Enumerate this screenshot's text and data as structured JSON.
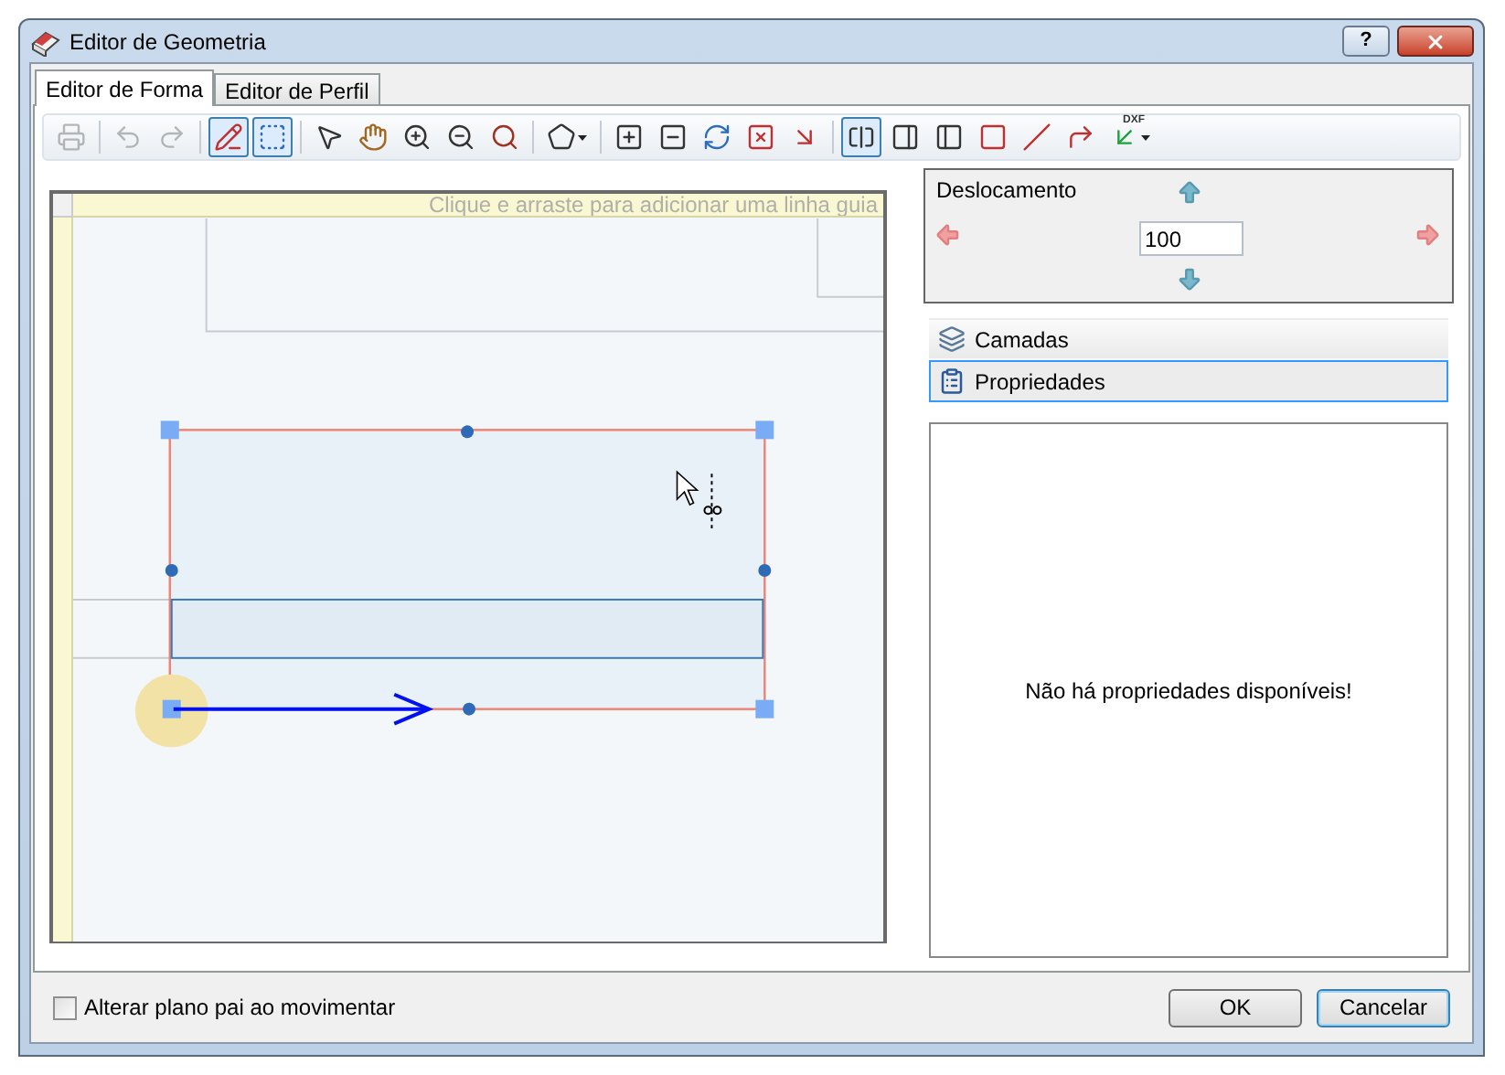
{
  "window": {
    "title": "Editor de Geometria",
    "help_button": "?"
  },
  "tabs": [
    {
      "label": "Editor de Forma",
      "selected": true
    },
    {
      "label": "Editor de Perfil",
      "selected": false
    }
  ],
  "toolbar": [
    {
      "kind": "button",
      "selected": false,
      "disabled": true
    },
    {
      "kind": "separator"
    },
    {
      "kind": "button",
      "selected": false,
      "disabled": true
    },
    {
      "kind": "button",
      "selected": false,
      "disabled": true
    },
    {
      "kind": "separator"
    },
    {
      "kind": "button",
      "selected": true,
      "disabled": false
    },
    {
      "kind": "button",
      "selected": true,
      "disabled": false
    },
    {
      "kind": "separator"
    },
    {
      "kind": "button",
      "selected": false,
      "disabled": false
    },
    {
      "kind": "button",
      "selected": false,
      "disabled": false
    },
    {
      "kind": "button",
      "selected": false,
      "disabled": false
    },
    {
      "kind": "button",
      "selected": false,
      "disabled": false
    },
    {
      "kind": "button",
      "selected": false,
      "disabled": false
    },
    {
      "kind": "separator"
    },
    {
      "kind": "button",
      "selected": false,
      "disabled": false,
      "dropdown": true
    },
    {
      "kind": "separator"
    },
    {
      "kind": "button",
      "selected": false,
      "disabled": false
    },
    {
      "kind": "button",
      "selected": false,
      "disabled": false
    },
    {
      "kind": "button",
      "selected": false,
      "disabled": false
    },
    {
      "kind": "button",
      "selected": false,
      "disabled": false
    },
    {
      "kind": "button",
      "selected": false,
      "disabled": false
    },
    {
      "kind": "separator"
    },
    {
      "kind": "button",
      "selected": true,
      "disabled": false
    },
    {
      "kind": "button",
      "selected": false,
      "disabled": false
    },
    {
      "kind": "button",
      "selected": false,
      "disabled": false
    },
    {
      "kind": "button",
      "selected": false,
      "disabled": false
    },
    {
      "kind": "button",
      "selected": false,
      "disabled": false
    },
    {
      "kind": "button",
      "selected": false,
      "disabled": false
    },
    {
      "kind": "button",
      "selected": false,
      "disabled": false,
      "dropdown": true,
      "label": "DXF"
    }
  ],
  "canvas": {
    "guide_hint": "Clique e arraste para adicionar uma linha guia"
  },
  "offset": {
    "label": "Deslocamento",
    "value": "100"
  },
  "sections": [
    {
      "label": "Camadas",
      "selected": false
    },
    {
      "label": "Propriedades",
      "selected": true
    }
  ],
  "properties": {
    "message": "Não há propriedades disponíveis!"
  },
  "option": {
    "label": "Alterar plano pai ao movimentar",
    "checked": false
  },
  "buttons": [
    {
      "label": "OK",
      "focused": false
    },
    {
      "label": "Cancelar",
      "focused": true
    }
  ]
}
